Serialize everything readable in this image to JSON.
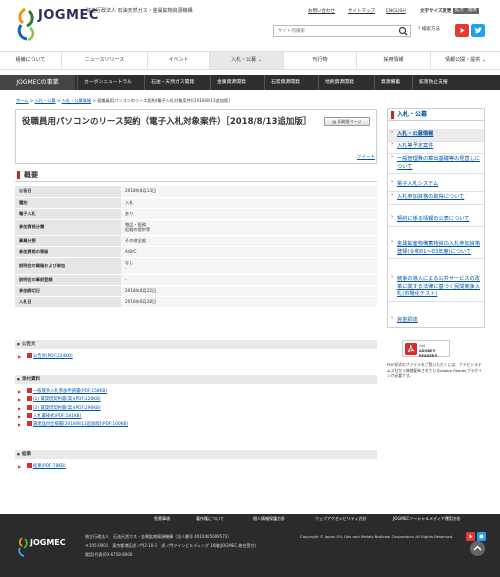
{
  "header": {
    "logo": "JOGMEC",
    "org_name": "独立行政法人 石油天然ガス・金属鉱物資源機構",
    "util_links": [
      "お問い合わせ",
      "サイトマップ",
      "ENGLISH",
      "文字サイズ変更",
      "拡大",
      "標準"
    ],
    "search_placeholder": "サイト内検索",
    "advanced_search": "検索方法"
  },
  "nav": {
    "items": [
      "組織について",
      "ニュースリリース",
      "イベント",
      "入札・公募",
      "刊行物",
      "採用情報",
      "情報公開・提供"
    ],
    "active_index": 3
  },
  "subnav": {
    "title": "JOGMECの事業",
    "items": [
      "カーボンニュートラル",
      "石油・天然ガス開発",
      "金属資源開発",
      "石炭資源開発",
      "地熱資源開発",
      "資源備蓄",
      "鉱害防止支援"
    ]
  },
  "breadcrumb": {
    "items": [
      "ホーム",
      "入札・公募",
      "入札・公募情報"
    ],
    "current": "役職員用パソコンのリース契約(電子入札対象案件)[2018/8/13追加版]"
  },
  "page": {
    "title": "役職員用パソコンのリース契約（電子入札対象案件）［2018/8/13追加版］",
    "print_label": "印刷用ページ",
    "tweet": "ツイート"
  },
  "overview": {
    "heading": "概要",
    "rows": [
      {
        "k": "公告日",
        "v": "2018年8月13日"
      },
      {
        "k": "種別",
        "v": "入札"
      },
      {
        "k": "電子入札",
        "v": "あり"
      },
      {
        "k": "参加資格分類",
        "v": "物品・役務\n役務の提供等"
      },
      {
        "k": "事業分野",
        "v": "その他全般"
      },
      {
        "k": "参加資格の等級",
        "v": "A/B/C"
      },
      {
        "k": "説明会の開催および参加",
        "v": "なし\n-"
      },
      {
        "k": "説明会の事前登録",
        "v": "-"
      },
      {
        "k": "参加締切日",
        "v": "2018年8月22日"
      },
      {
        "k": "入札日",
        "v": "2018年8月28日"
      }
    ]
  },
  "notice": {
    "heading": "公告文",
    "files": [
      "公告文(PDF:224KB)"
    ]
  },
  "attachments": {
    "heading": "添付資料",
    "files": [
      "一般競争入札参加申請書(PDF:158KB)",
      "(1) 賃貸借契約書(案)(PDF:228KB)",
      "(2) 賃貸借契約書(案)(PDF:296KB)",
      "入札書様式(PDF:181KB)",
      "調達品目仕様書[2018/8/13追加版](PDF:100KB)"
    ]
  },
  "result": {
    "heading": "結果",
    "files": [
      "結果(PDF:78KB)"
    ]
  },
  "sidebar": {
    "head": "入札・公募",
    "items": [
      "入札・公募情報",
      "入札等予定案件",
      "一般管理費の算出基礎等の見直しについて",
      "電子入札システム",
      "入札参加資格の取得について",
      "契約に係る情報の公表について",
      "金属鉱産物備蓄物資の入札参加資格登録(令和01〜03年度)について",
      "競争の導入による公共サービスの改革に関する法律に基づく民間競争入札(市場化テスト)",
      "資金調達"
    ],
    "active_index": 0
  },
  "reader": {
    "logo_line1": "Get",
    "logo_line2": "ADOBE® READER®",
    "text": "PDF形式のファイルをご覧いただくには、アドビシステムズ社から無償配布されているAdobe Readerプラグインが必要です。"
  },
  "footer": {
    "links": [
      "免責事項",
      "著作権について",
      "個人情報保護方針",
      "ウェブアクセシビリティ方針",
      "JOGMECソーシャルメディア運用方針"
    ],
    "logo": "JOGMEC",
    "org": "独立行政法人　石油天然ガス・金属鉱物資源機構（法人番号 4010405009573）",
    "address": "〒105-0001　東京都港区虎ノ門2-10-1　虎ノ門ツインビルディング 16階(JOGMEC 総合受付)",
    "phone": "電話(代表)03-6758-8000",
    "copyright": "Copyright © Japan Oil, Gas and Metals National Corporation All Rights Reserved."
  }
}
